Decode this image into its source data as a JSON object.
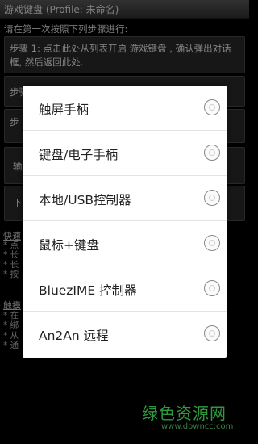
{
  "title": "游戏键盘 (Profile: 未命名)",
  "instruction": "请在第一次按照下列步骤进行:",
  "steps": [
    {
      "label": "步骤 1: 点击此处从列表开启 游戏键盘 , 确认弹出对话框, 然后返回此处."
    },
    {
      "label": "步骤"
    },
    {
      "label": "步"
    },
    {
      "label": "输"
    },
    {
      "label": "下"
    }
  ],
  "side": {
    "quick_head": "快速",
    "quick_lines": [
      "* 点",
      "* 长",
      "* 长",
      "* 按"
    ],
    "touch_head": "触摸",
    "touch_lines": [
      "* 在",
      "* 绑",
      "* 从",
      "* 通"
    ]
  },
  "dialog": {
    "options": [
      {
        "label": "触屏手柄",
        "selected": false
      },
      {
        "label": "键盘/电子手柄",
        "selected": false
      },
      {
        "label": "本地/USB控制器",
        "selected": false
      },
      {
        "label": "鼠标+键盘",
        "selected": false
      },
      {
        "label": "BluezIME 控制器",
        "selected": false
      },
      {
        "label": "An2An 远程",
        "selected": false
      }
    ]
  },
  "watermark": {
    "text": "绿色资源网",
    "url": "www.downcc.com"
  }
}
